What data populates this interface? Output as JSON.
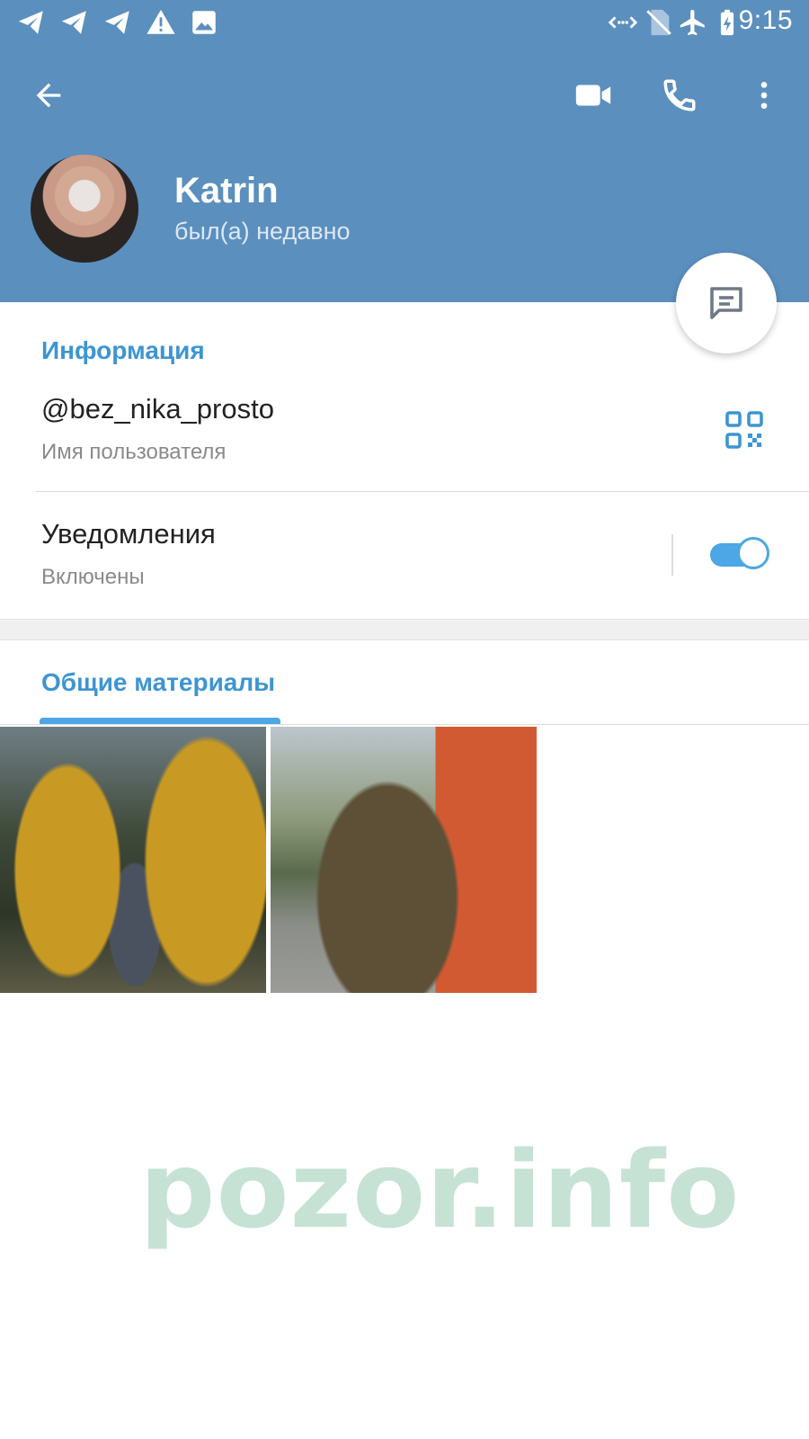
{
  "status_bar": {
    "time": "9:15",
    "left_icons": [
      "telegram-icon",
      "telegram-icon",
      "telegram-icon",
      "warning-icon",
      "image-icon"
    ],
    "right_icons": [
      "data-transfer-icon",
      "no-sim-icon",
      "airplane-icon",
      "battery-charging-icon"
    ]
  },
  "toolbar": {
    "back_icon": "arrow-left-icon",
    "video_call_icon": "video-camera-icon",
    "call_icon": "phone-icon",
    "more_icon": "more-vertical-icon"
  },
  "profile": {
    "name": "Katrin",
    "status": "был(а) недавно"
  },
  "fab": {
    "icon": "message-icon"
  },
  "info": {
    "section_title": "Информация",
    "username": "@bez_nika_prosto",
    "username_label": "Имя пользователя",
    "notifications_title": "Уведомления",
    "notifications_status": "Включены",
    "notifications_enabled": true
  },
  "shared": {
    "tab_label": "Общие материалы",
    "media_count": 2
  },
  "watermark": "pozor.info",
  "colors": {
    "header": "#5b8fbe",
    "accent": "#3d95d2",
    "toggle": "#4da6e5",
    "watermark": "#c6e2d4"
  }
}
